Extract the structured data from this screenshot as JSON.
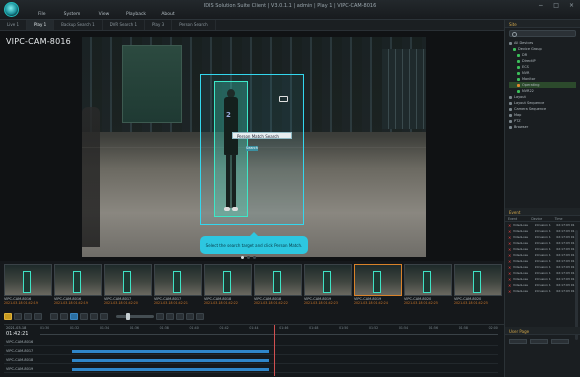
{
  "window": {
    "title": "IDIS Solution Suite Client | V3.0.1.1 | admin | Play 1 | VIPC-CAM-8016",
    "controls": [
      "−",
      "□",
      "×"
    ]
  },
  "menu": [
    "File",
    "System",
    "View",
    "Playback",
    "About"
  ],
  "tabs": [
    {
      "label": "Live 1",
      "active": false
    },
    {
      "label": "Play 1",
      "active": true
    },
    {
      "label": "Backup Search 1",
      "active": false
    },
    {
      "label": "DVR Search 1",
      "active": false
    },
    {
      "label": "Play 3",
      "active": false
    },
    {
      "label": "Person Search",
      "active": false
    }
  ],
  "video": {
    "camera_label": "VIPC-CAM-8016",
    "context_menu_label": "Person Match Search",
    "context_sub_label": "Search",
    "tooltip": "Select the search target and click Person Match.",
    "pager_active": 1,
    "pager_count": 3
  },
  "thumbnails": [
    {
      "cam": "VIPC-CAM-8016",
      "time": "2021-03-18 01:42:19",
      "selected": false
    },
    {
      "cam": "VIPC-CAM-8016",
      "time": "2021-03-18 01:42:19",
      "selected": false
    },
    {
      "cam": "VIPC-CAM-8017",
      "time": "2021-03-18 01:42:20",
      "selected": false
    },
    {
      "cam": "VIPC-CAM-8017",
      "time": "2021-03-18 01:42:21",
      "selected": false
    },
    {
      "cam": "VIPC-CAM-8018",
      "time": "2021-03-18 01:42:22",
      "selected": false
    },
    {
      "cam": "VIPC-CAM-8018",
      "time": "2021-03-18 01:42:22",
      "selected": false
    },
    {
      "cam": "VIPC-CAM-8019",
      "time": "2021-03-18 01:42:23",
      "selected": false
    },
    {
      "cam": "VIPC-CAM-8019",
      "time": "2021-03-18 01:42:24",
      "selected": true
    },
    {
      "cam": "VIPC-CAM-8020",
      "time": "2021-03-18 01:42:25",
      "selected": false
    },
    {
      "cam": "VIPC-CAM-8020",
      "time": "2021-03-18 01:42:25",
      "selected": false
    }
  ],
  "timeline": {
    "date": "2021-03-18",
    "time": "01:42:21",
    "ticks": [
      "01:30",
      "01:32",
      "01:34",
      "01:36",
      "01:38",
      "01:40",
      "01:42",
      "01:44",
      "01:46",
      "01:48",
      "01:50",
      "01:52",
      "01:54",
      "01:56",
      "01:58",
      "02:00"
    ],
    "rows": [
      {
        "label": "VIPC-CAM-8016",
        "bar_start": 0.0,
        "bar_end": 0.0
      },
      {
        "label": "VIPC-CAM-8017",
        "bar_start": 0.07,
        "bar_end": 0.5
      },
      {
        "label": "VIPC-CAM-8018",
        "bar_start": 0.07,
        "bar_end": 0.5
      },
      {
        "label": "VIPC-CAM-8019",
        "bar_start": 0.07,
        "bar_end": 0.5
      }
    ]
  },
  "right_panel": {
    "site_title": "Site",
    "tree": [
      {
        "label": "All Devices",
        "color": "gray",
        "highlight": false
      },
      {
        "label": "Device Group",
        "color": "green",
        "highlight": false
      },
      {
        "label": "DR",
        "color": "green",
        "highlight": false
      },
      {
        "label": "DirectIP",
        "color": "green",
        "highlight": false
      },
      {
        "label": "ECS",
        "color": "green",
        "highlight": false
      },
      {
        "label": "NVR",
        "color": "green",
        "highlight": false
      },
      {
        "label": "Monitor",
        "color": "green",
        "highlight": false
      },
      {
        "label": "Operating",
        "color": "orange",
        "highlight": true
      },
      {
        "label": "NVR22",
        "color": "green",
        "highlight": false
      },
      {
        "label": "Layout",
        "color": "gray",
        "highlight": false
      },
      {
        "label": "Layout Sequence",
        "color": "gray",
        "highlight": false
      },
      {
        "label": "Camera Sequence",
        "color": "gray",
        "highlight": false
      },
      {
        "label": "Map",
        "color": "gray",
        "highlight": false
      },
      {
        "label": "PTZ",
        "color": "gray",
        "highlight": false
      },
      {
        "label": "Browser",
        "color": "gray",
        "highlight": false
      }
    ],
    "events_title": "Event",
    "events_columns": [
      "Event",
      "Device",
      "Time"
    ],
    "events": [
      {
        "event": "VideoLoss",
        "device": "Intrusion 1",
        "time": "02:17:03 01"
      },
      {
        "event": "VideoLoss",
        "device": "Intrusion 1",
        "time": "02:17:03 01"
      },
      {
        "event": "VideoLoss",
        "device": "Intrusion 1",
        "time": "02:17:03 01"
      },
      {
        "event": "VideoLoss",
        "device": "Intrusion 1",
        "time": "02:17:03 01"
      },
      {
        "event": "VideoLoss",
        "device": "Intrusion 1",
        "time": "02:17:03 01"
      },
      {
        "event": "VideoLoss",
        "device": "Intrusion 1",
        "time": "02:17:03 01"
      },
      {
        "event": "VideoLoss",
        "device": "Intrusion 1",
        "time": "02:17:03 01"
      },
      {
        "event": "VideoLoss",
        "device": "Intrusion 1",
        "time": "02:17:03 01"
      },
      {
        "event": "VideoLoss",
        "device": "Intrusion 1",
        "time": "02:17:03 01"
      },
      {
        "event": "VideoLoss",
        "device": "Intrusion 1",
        "time": "02:17:03 01"
      },
      {
        "event": "VideoLoss",
        "device": "Intrusion 1",
        "time": "02:17:03 01"
      },
      {
        "event": "VideoLoss",
        "device": "Intrusion 1",
        "time": "02:17:03 01"
      }
    ],
    "user_page_title": "User Page"
  },
  "toolbar_icons": [
    "lock-icon",
    "camera-icon",
    "zoom-icon",
    "grid-icon",
    "rewind-icon",
    "step-back-icon",
    "pause-icon",
    "play-icon",
    "step-forward-icon",
    "fast-forward-icon",
    "export-icon",
    "print-icon",
    "snapshot-icon",
    "bookmark-icon",
    "settings-icon"
  ]
}
